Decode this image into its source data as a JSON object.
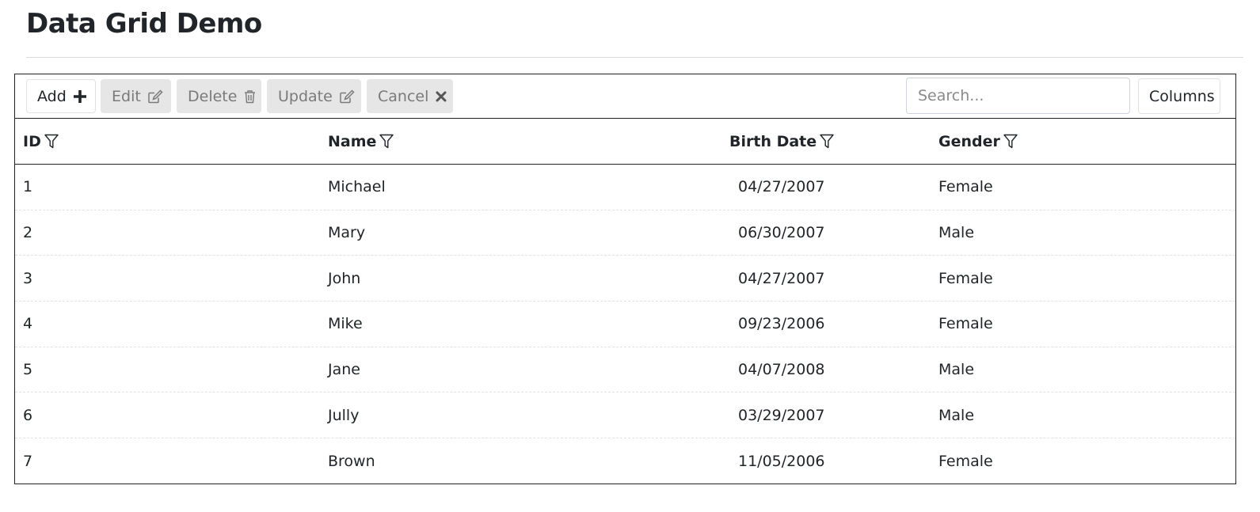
{
  "page": {
    "title": "Data Grid Demo"
  },
  "toolbar": {
    "add_label": "Add",
    "edit_label": "Edit",
    "delete_label": "Delete",
    "update_label": "Update",
    "cancel_label": "Cancel",
    "search_placeholder": "Search...",
    "search_value": "",
    "columns_label": "Columns",
    "icons": {
      "add": "plus-icon",
      "edit": "edit-icon",
      "delete": "trash-icon",
      "update": "edit-icon",
      "cancel": "close-icon",
      "filter": "filter-icon"
    }
  },
  "grid": {
    "columns": [
      {
        "label": "ID"
      },
      {
        "label": "Name"
      },
      {
        "label": "Birth Date"
      },
      {
        "label": "Gender"
      }
    ],
    "rows": [
      {
        "id": "1",
        "name": "Michael",
        "birth_date": "04/27/2007",
        "gender": "Female"
      },
      {
        "id": "2",
        "name": "Mary",
        "birth_date": "06/30/2007",
        "gender": "Male"
      },
      {
        "id": "3",
        "name": "John",
        "birth_date": "04/27/2007",
        "gender": "Female"
      },
      {
        "id": "4",
        "name": "Mike",
        "birth_date": "09/23/2006",
        "gender": "Female"
      },
      {
        "id": "5",
        "name": "Jane",
        "birth_date": "04/07/2008",
        "gender": "Male"
      },
      {
        "id": "6",
        "name": "Jully",
        "birth_date": "03/29/2007",
        "gender": "Male"
      },
      {
        "id": "7",
        "name": "Brown",
        "birth_date": "11/05/2006",
        "gender": "Female"
      }
    ]
  },
  "colors": {
    "text": "#212529",
    "disabled_bg": "#e6e6e6",
    "disabled_text": "#7a7a7a",
    "border": "#222222"
  }
}
